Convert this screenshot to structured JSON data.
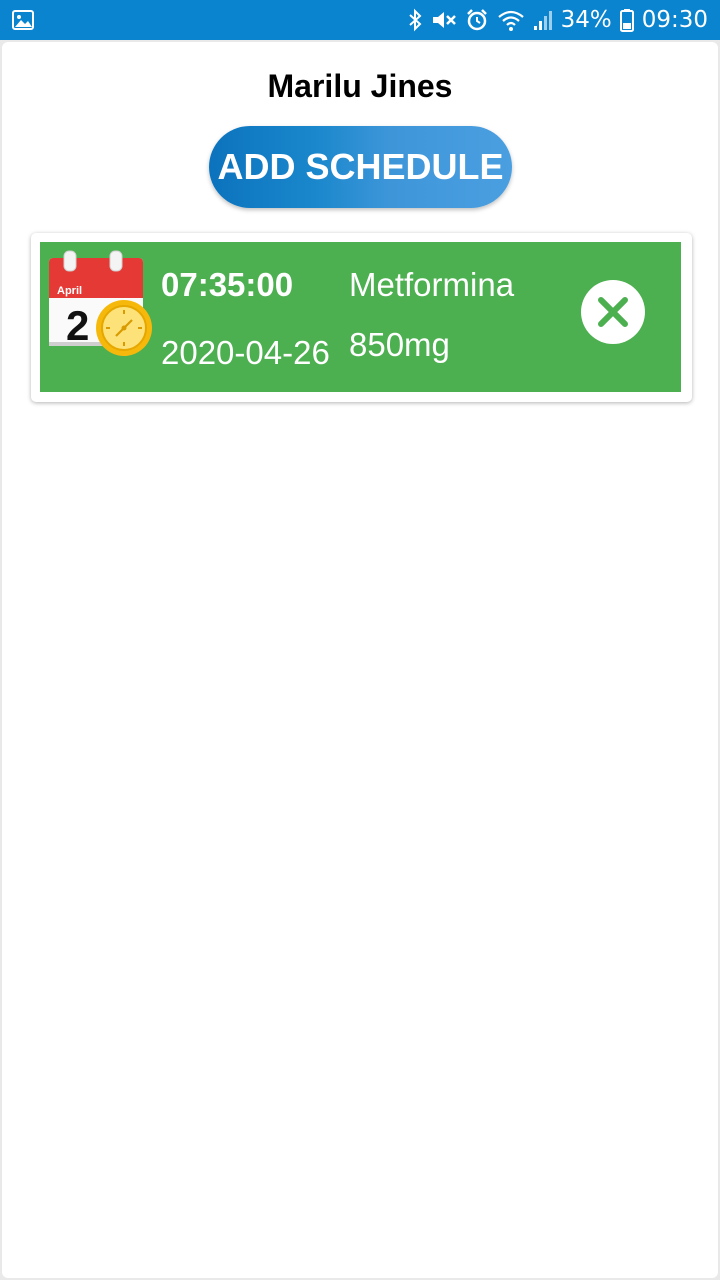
{
  "status_bar": {
    "battery": "34%",
    "time": "09:30",
    "color": "#0a84cf",
    "icons": [
      "image-icon",
      "bluetooth-icon",
      "mute-icon",
      "alarm-icon",
      "wifi-icon",
      "signal-icon",
      "battery-icon"
    ]
  },
  "header": {
    "user_name": "Marilu Jines"
  },
  "actions": {
    "add_schedule_label": "ADD SCHEDULE"
  },
  "schedules": [
    {
      "calendar_month": "April",
      "calendar_day": "2",
      "time": "07:35:00",
      "date": "2020-04-26",
      "medication": "Metformina",
      "dose": "850mg",
      "delete_icon": "close-icon",
      "card_color": "#4caf50"
    }
  ]
}
